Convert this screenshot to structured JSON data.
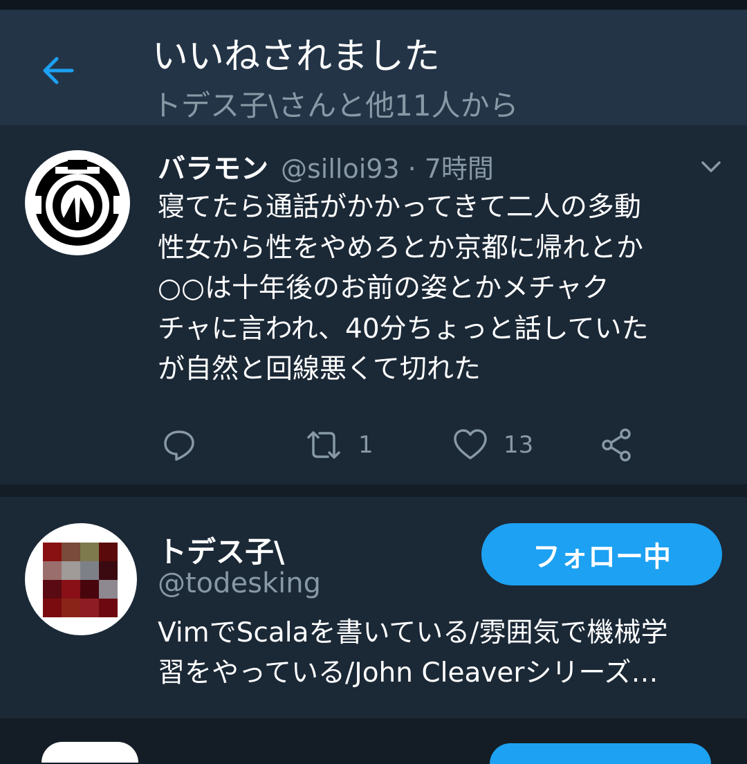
{
  "header": {
    "title": "いいねされました",
    "subtitle": "トデス子\\さんと他11人から"
  },
  "tweet": {
    "display_name": "バラモン",
    "handle": "@silloi93",
    "separator": "·",
    "time": "7時間",
    "body_lines": [
      "寝てたら通話がかかってきて二人の多動",
      "性女から性をやめろとか京都に帰れとか",
      "○○は十年後のお前の姿とかメチャク",
      "チャに言われ、40分ちょっと話していた",
      "が自然と回線悪くて切れた"
    ],
    "retweet_count": "1",
    "like_count": "13",
    "icons": [
      "reply-icon",
      "retweet-icon",
      "like-icon",
      "share-icon",
      "chevron-down-icon"
    ]
  },
  "user": {
    "display_name": "トデス子\\",
    "handle": "@todesking",
    "follow_label": "フォロー中",
    "bio_lines": [
      "VimでScalaを書いている/雰囲気で機械学",
      "習をやっている/John Cleaverシリーズ…"
    ]
  },
  "colors": {
    "background": "#141d26",
    "card": "#1b2836",
    "header": "#243447",
    "accent": "#1da1f2",
    "secondary_text": "#8899a6"
  }
}
